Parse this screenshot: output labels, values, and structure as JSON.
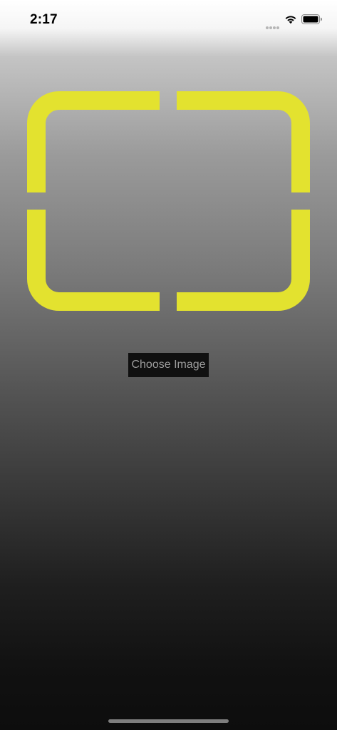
{
  "status_bar": {
    "time": "2:17",
    "icons": [
      "signal-dots-icon",
      "wifi-icon",
      "battery-icon"
    ]
  },
  "scanner": {
    "frame_color": "#e3e22f"
  },
  "actions": {
    "choose_image_label": "Choose Image"
  },
  "colors": {
    "background_top": "#ffffff",
    "background_bottom": "#0d0d0d",
    "button_background": "#101010",
    "button_text": "#9c9c9c"
  }
}
